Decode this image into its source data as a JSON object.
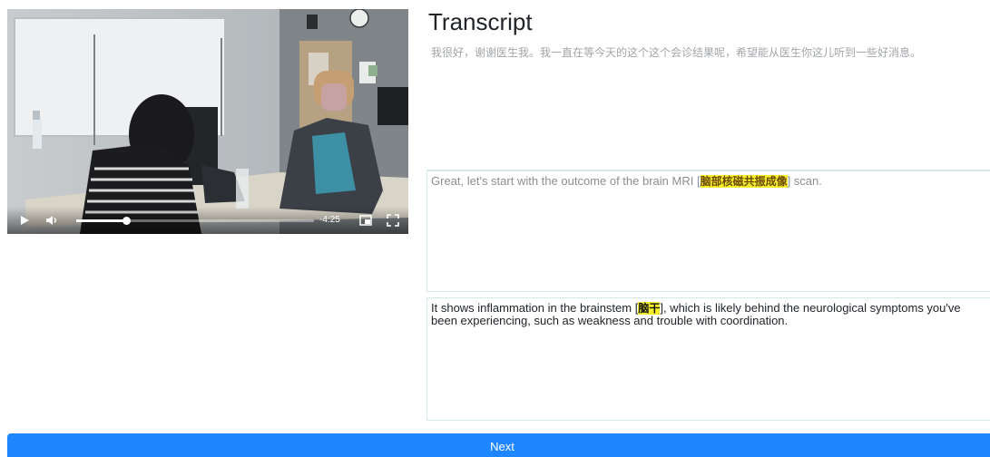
{
  "video": {
    "time_label": "-4:25",
    "progress_fraction": 0.21
  },
  "transcript": {
    "title": "Transcript",
    "segments": [
      {
        "before": "我很好，谢谢医生我。我一直在等今天的这个这个会诊结果呢，希望能从医生你这儿听到一些好消息。"
      },
      {
        "before": "Great, let's start with the outcome of the brain MRI [",
        "term": "脑部核磁共振成像",
        "after": "] scan."
      },
      {
        "before": "It shows inflammation in the brainstem [",
        "term": "脑干",
        "after": "], which is likely behind the neurological symptoms you've been experiencing, such as weakness and trouble with coordination."
      }
    ]
  },
  "next_button": {
    "label": "Next",
    "color": "#1e86ff"
  }
}
